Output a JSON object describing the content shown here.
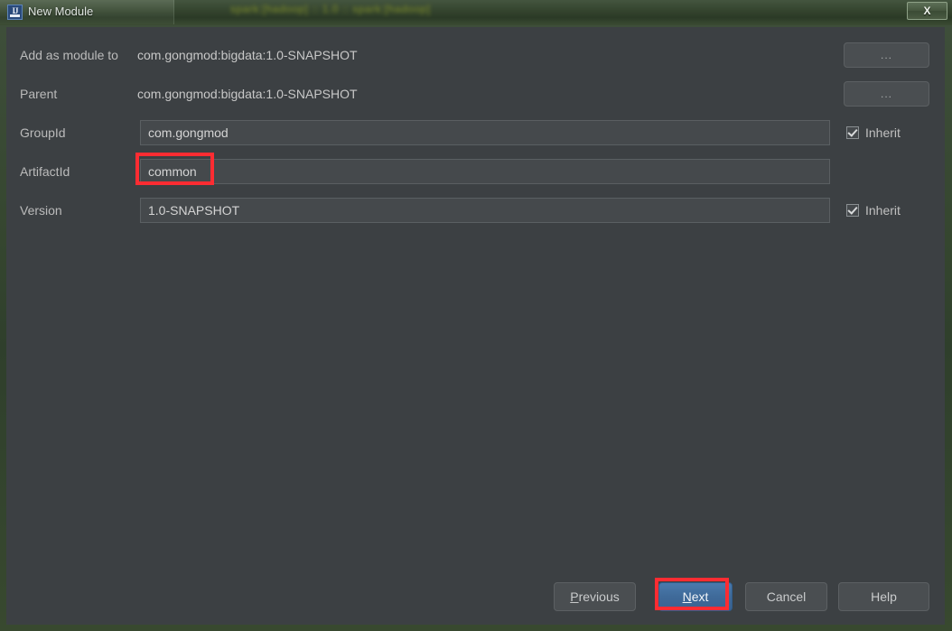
{
  "window": {
    "title": "New Module",
    "icon": "intellij-idea-icon",
    "close_label": "X",
    "background_blur_text": "spark:[hadoop] :: 1.0 :: spark:[hadoop]"
  },
  "form": {
    "rows": [
      {
        "label": "Add as module to",
        "type": "static",
        "value": "com.gongmod:bigdata:1.0-SNAPSHOT",
        "trailing": "ellipsis-button",
        "trailing_label": "..."
      },
      {
        "label": "Parent",
        "type": "static",
        "value": "com.gongmod:bigdata:1.0-SNAPSHOT",
        "trailing": "ellipsis-button",
        "trailing_label": "..."
      },
      {
        "label": "GroupId",
        "type": "input",
        "value": "com.gongmod",
        "trailing": "inherit-checkbox",
        "trailing_label": "Inherit",
        "trailing_checked": true
      },
      {
        "label": "ArtifactId",
        "type": "input",
        "value": "common",
        "trailing": "none",
        "trailing_label": "",
        "highlighted": true
      },
      {
        "label": "Version",
        "type": "input",
        "value": "1.0-SNAPSHOT",
        "trailing": "inherit-checkbox",
        "trailing_label": "Inherit",
        "trailing_checked": true
      }
    ]
  },
  "buttons": {
    "previous": {
      "label": "Previous",
      "mnemonic": "P"
    },
    "next": {
      "label": "Next",
      "mnemonic": "N",
      "primary": true,
      "highlighted": true
    },
    "cancel": {
      "label": "Cancel"
    },
    "help": {
      "label": "Help"
    }
  },
  "colors": {
    "dialog_background": "#3c4043",
    "field_background": "#45494c",
    "accent_blue": "#3f6a99",
    "annotation_red": "#fd2c32",
    "title_bar": "#33432d"
  }
}
